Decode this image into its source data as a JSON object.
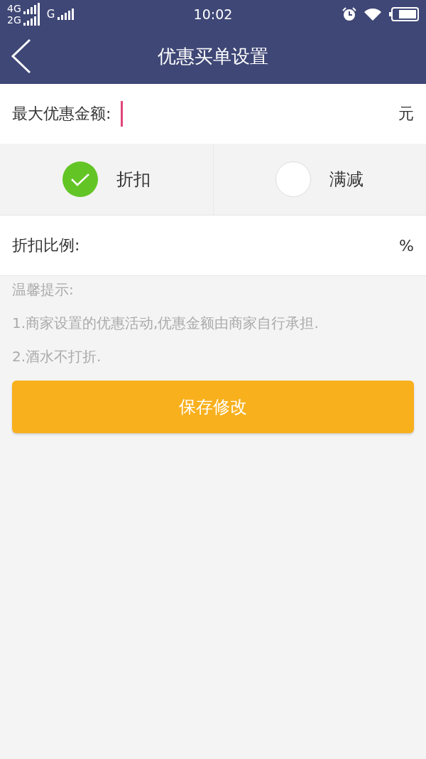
{
  "status_bar": {
    "network_1": "4G",
    "network_2": "2G",
    "network_3": "G",
    "time": "10:02"
  },
  "nav_bar": {
    "title": "优惠买单设置"
  },
  "amount_field": {
    "label": "最大优惠金额:",
    "unit": "元",
    "focused": true
  },
  "discount_types": [
    {
      "label": "折扣",
      "selected": true
    },
    {
      "label": "满减",
      "selected": false
    }
  ],
  "ratio_field": {
    "label": "折扣比例:",
    "unit": "%"
  },
  "tips": {
    "title": "温馨提示:",
    "lines": [
      "1.商家设置的优惠活动,优惠金额由商家自行承担.",
      "2.酒水不打折."
    ]
  },
  "save_button": {
    "label": "保存修改"
  }
}
